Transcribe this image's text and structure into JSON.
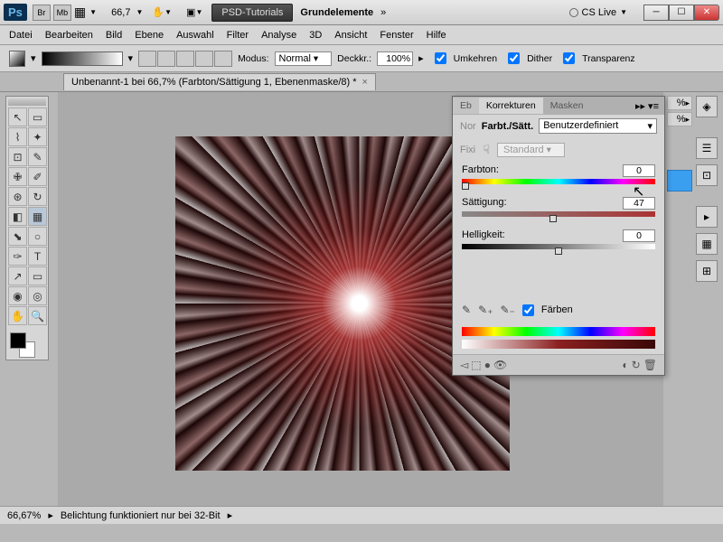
{
  "title": {
    "ps": "Ps",
    "br": "Br",
    "mb": "Mb",
    "zoom": "66,7",
    "btn1": "PSD-Tutorials",
    "btn2": "Grundelemente",
    "cslive": "CS Live"
  },
  "menu": [
    "Datei",
    "Bearbeiten",
    "Bild",
    "Ebene",
    "Auswahl",
    "Filter",
    "Analyse",
    "3D",
    "Ansicht",
    "Fenster",
    "Hilfe"
  ],
  "opt": {
    "modus": "Modus:",
    "modus_v": "Normal",
    "deck": "Deckkr.:",
    "deck_v": "100%",
    "umk": "Umkehren",
    "dith": "Dither",
    "trans": "Transparenz"
  },
  "doctab": "Unbenannt-1 bei 66,7% (Farbton/Sättigung 1, Ebenenmaske/8) *",
  "panel": {
    "tab_eb": "Eb",
    "tab_korr": "Korrekturen",
    "tab_mask": "Masken",
    "row_nor": "Nor",
    "row_title": "Farbt./Sätt.",
    "preset": "Benutzerdefiniert",
    "row_fix": "Fixi",
    "std": "Standard",
    "hue_l": "Farbton:",
    "hue_v": "0",
    "sat_l": "Sättigung:",
    "sat_v": "47",
    "lig_l": "Helligkeit:",
    "lig_v": "0",
    "farben": "Färben",
    "pct": "%"
  },
  "status": {
    "zoom": "66,67%",
    "msg": "Belichtung funktioniert nur bei 32-Bit"
  }
}
